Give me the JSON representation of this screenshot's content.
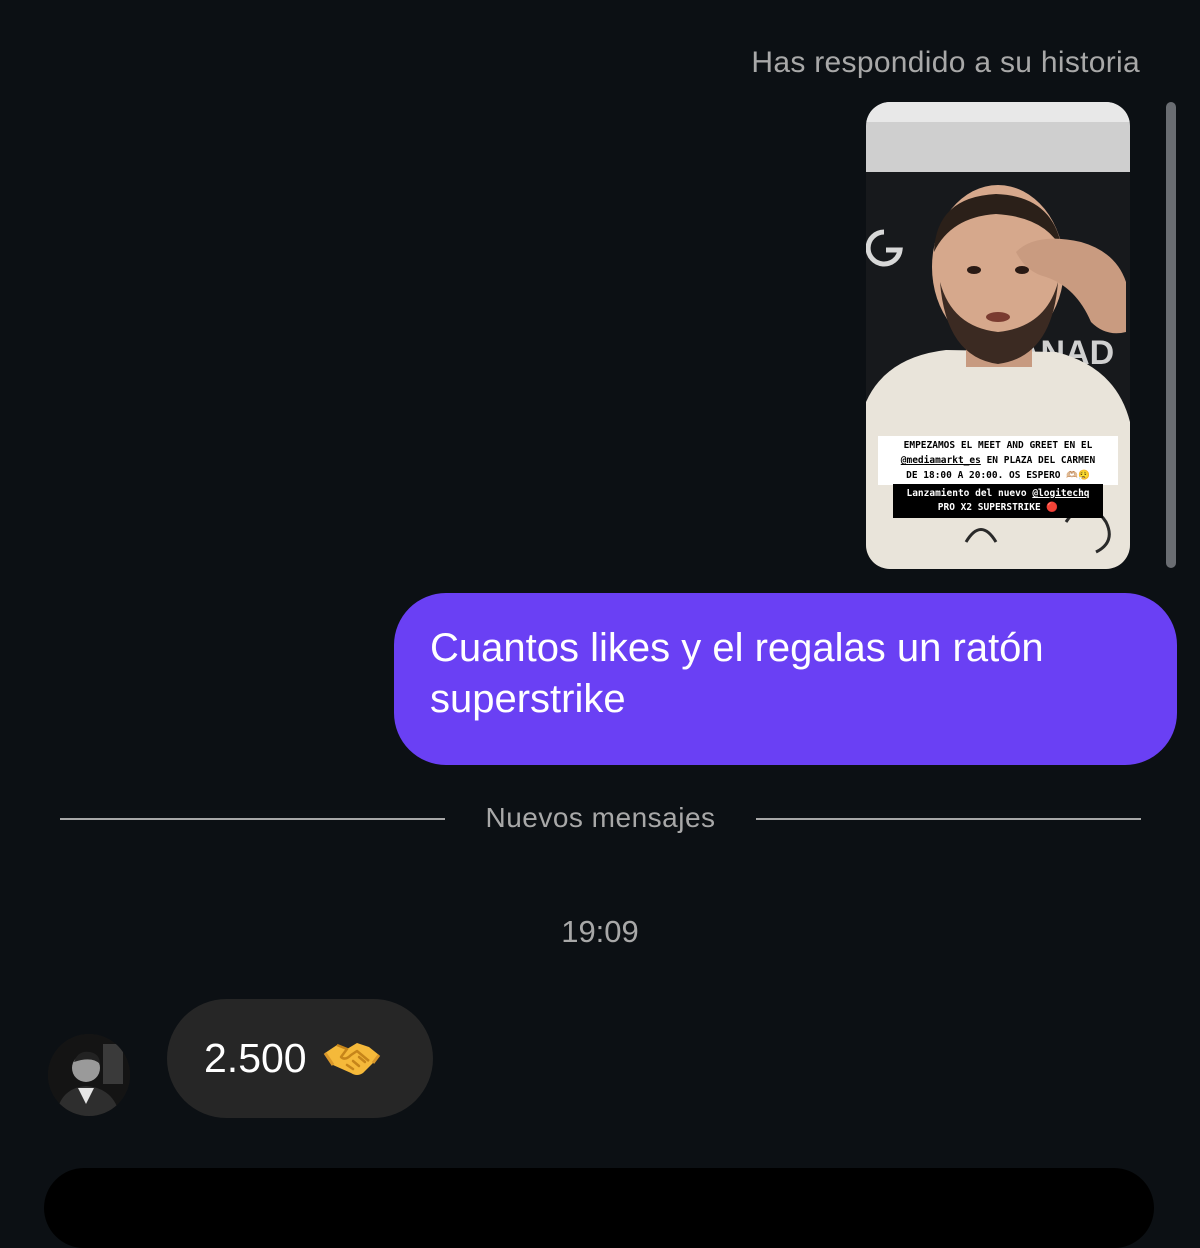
{
  "reply_note": "Has respondido a su historia",
  "story": {
    "caption_line1": "EMPEZAMOS EL MEET AND GREET EN EL",
    "caption_mention": "@mediamarkt_es",
    "caption_line2_rest": " EN PLAZA DEL CARMEN",
    "caption_line3": "DE 18:00 A 20:00. OS ESPERO 🫶🏼😮‍💨",
    "launch_prefix": "Lanzamiento del nuevo ",
    "launch_mention": "@logitechq",
    "launch_line2": "PRO X2 SUPERSTRIKE 🔴",
    "bg_letters": "ANAD"
  },
  "sent_message": "Cuantos likes y el regalas un ratón superstrike",
  "divider_label": "Nuevos mensajes",
  "timestamp": "19:09",
  "received_message": {
    "text": "2.500",
    "emoji": "handshake-emoji"
  },
  "colors": {
    "background": "#0c1014",
    "sent_bubble": "#6a40f4",
    "received_bubble": "#262626",
    "muted_text": "#a8a8a8"
  }
}
